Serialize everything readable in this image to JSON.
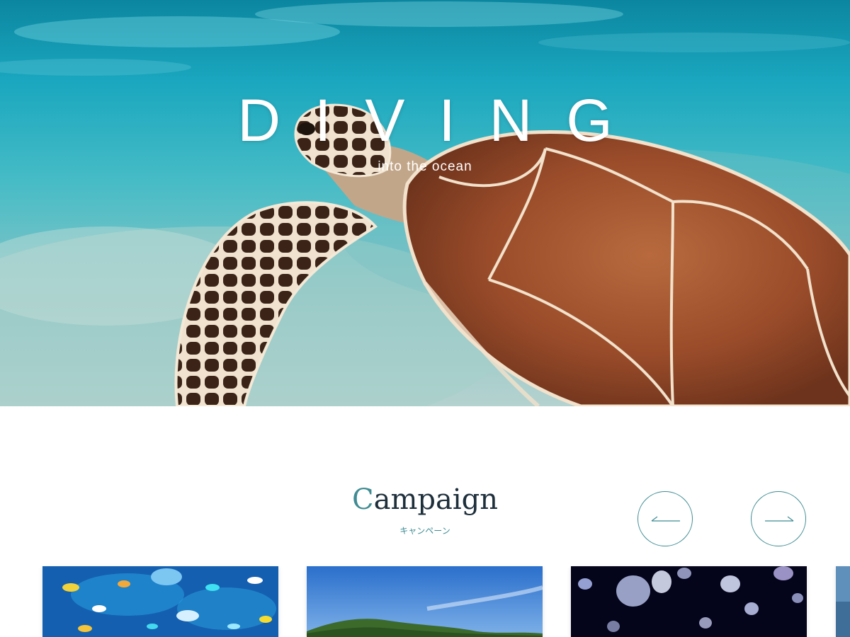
{
  "hero": {
    "title": "DIVING",
    "subtitle": "into the ocean",
    "image": "sea-turtle-photo"
  },
  "campaign": {
    "title_initial": "C",
    "title_rest": "ampaign",
    "subtitle": "キャンペーン",
    "prev_icon": "arrow-left-icon",
    "next_icon": "arrow-right-icon",
    "accent_color": "#3f8c93",
    "cards": [
      {
        "image": "tropical-fish-photo"
      },
      {
        "image": "island-sky-photo"
      },
      {
        "image": "jellyfish-photo"
      },
      {
        "image": "ocean-photo"
      }
    ]
  }
}
